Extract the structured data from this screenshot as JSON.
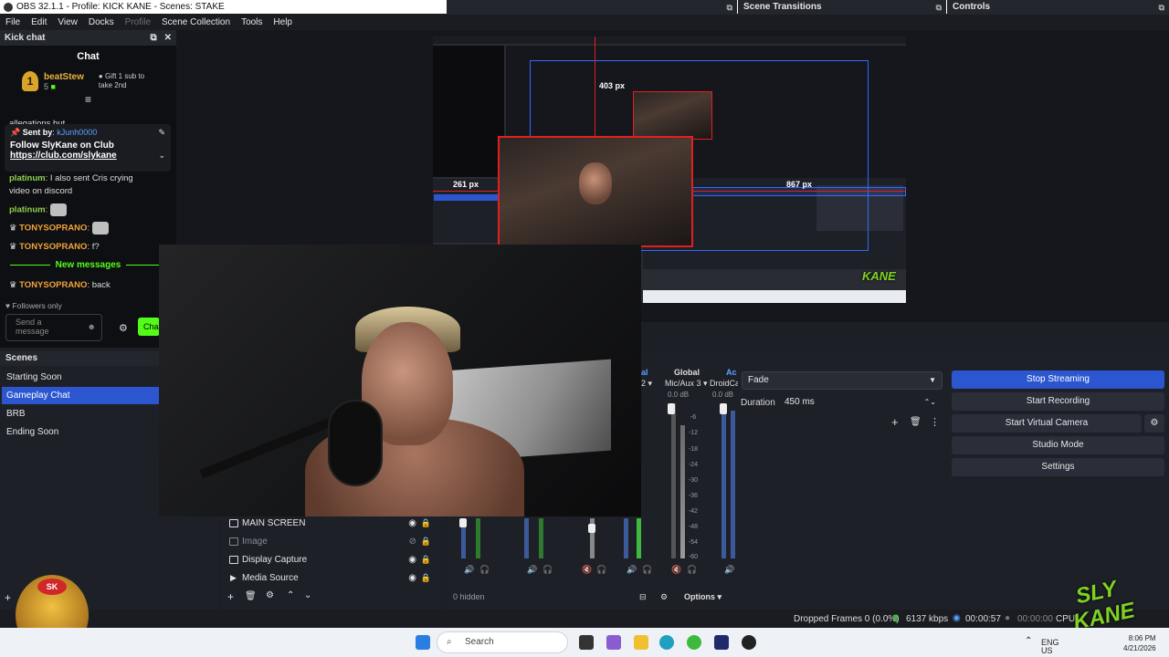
{
  "window": {
    "title": "OBS 32.1.1 - Profile: KICK KANE - Scenes: STAKE"
  },
  "menu": [
    "File",
    "Edit",
    "View",
    "Docks",
    "Profile",
    "Scene Collection",
    "Tools",
    "Help"
  ],
  "chat": {
    "dock_title": "Kick chat",
    "header": "Chat",
    "leader": {
      "rank": "1",
      "name": "beatStew",
      "subs": "5",
      "gift_line1": "Gift 1 sub to",
      "gift_line2": "take 2nd"
    },
    "partial_text": "allegations but",
    "pinned": {
      "sent_by": "Sent by",
      "user": "kJunh0000",
      "title": "Follow SlyKane on Club",
      "link": "https://club.com/slykane"
    },
    "messages": [
      {
        "user": "platinum",
        "text": "I also sent Cris crying"
      },
      {
        "user": "",
        "text": "video on discord"
      },
      {
        "user": "platinum",
        "text": ""
      },
      {
        "user": "TONYSOPRANO",
        "text": ""
      },
      {
        "user": "TONYSOPRANO",
        "text": "f?"
      }
    ],
    "new_messages": "New messages",
    "last_message": {
      "user": "TONYSOPRANO",
      "text": "back"
    },
    "followers_only": "Followers only",
    "send_placeholder_1": "Send a",
    "send_placeholder_2": "message",
    "chat_button": "Cha"
  },
  "preview": {
    "label_403": "403 px",
    "label_261": "261 px",
    "label_867": "867 px"
  },
  "scenes": {
    "title": "Scenes",
    "items": [
      "Starting Soon",
      "Gameplay Chat",
      "BRB",
      "Ending Soon"
    ],
    "selected": "Gameplay Chat"
  },
  "sources": {
    "items": [
      {
        "name": "MAIN SCREEN",
        "visible": true
      },
      {
        "name": "Image",
        "visible": false
      },
      {
        "name": "Display Capture",
        "visible": true
      },
      {
        "name": "Media Source",
        "visible": true
      }
    ]
  },
  "mixer": {
    "header_left": "al",
    "header_global": "Global",
    "header_right": "Ac",
    "channels": [
      {
        "name": "2",
        "db": ""
      },
      {
        "name": "Mic/Aux 3",
        "db": "0.0 dB"
      },
      {
        "name": "DroidCa",
        "db": "0.0 dB"
      }
    ],
    "scale": [
      "-6",
      "-12",
      "-18",
      "-24",
      "-30",
      "-36",
      "-42",
      "-48",
      "-54",
      "-60"
    ],
    "hidden": "0 hidden",
    "options": "Options",
    "left_db": "0.0 dB"
  },
  "transitions": {
    "title": "Scene Transitions",
    "type": "Fade",
    "duration_label": "Duration",
    "duration_value": "450 ms"
  },
  "controls": {
    "title": "Controls",
    "stop_streaming": "Stop Streaming",
    "start_recording": "Start Recording",
    "start_virtual_camera": "Start Virtual Camera",
    "studio_mode": "Studio Mode",
    "settings": "Settings"
  },
  "status": {
    "dropped": "Dropped Frames 0 (0.0%)",
    "bitrate": "6137 kbps",
    "stream_time": "00:00:57",
    "rec_time": "00:00:00",
    "cpu": "CPU"
  },
  "taskbar": {
    "search": "Search",
    "lang1": "ENG",
    "lang2": "US",
    "time": "8:06 PM",
    "date": "4/21/2026"
  },
  "overlay": {
    "avatar_badge": "SK",
    "logo_top": "SLY",
    "logo_bottom": "KANE"
  },
  "colors": {
    "accent": "#2b56d0",
    "kick_green": "#53fc18",
    "selection_blue": "#2e6bff",
    "selection_red": "#e02020"
  }
}
